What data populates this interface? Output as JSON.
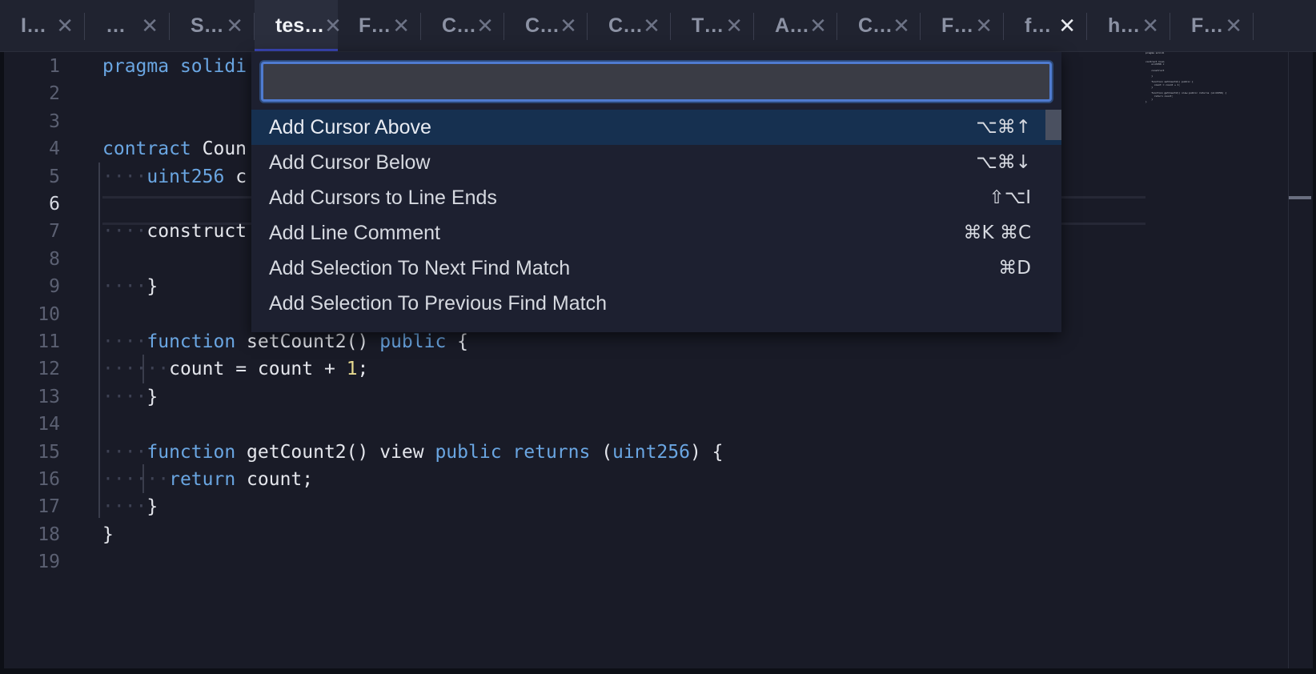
{
  "tabs": [
    {
      "label": "I…",
      "active": false
    },
    {
      "label": "…",
      "active": false
    },
    {
      "label": "S…",
      "active": false
    },
    {
      "label": "tes…",
      "active": true
    },
    {
      "label": "F…",
      "active": false
    },
    {
      "label": "C…",
      "active": false
    },
    {
      "label": "C…",
      "active": false
    },
    {
      "label": "C…",
      "active": false
    },
    {
      "label": "T…",
      "active": false
    },
    {
      "label": "A…",
      "active": false
    },
    {
      "label": "C…",
      "active": false
    },
    {
      "label": "F…",
      "active": false
    },
    {
      "label": "f…",
      "active": false
    },
    {
      "label": "h…",
      "active": false
    },
    {
      "label": "F…",
      "active": false
    }
  ],
  "tab_close_glyph": "✕",
  "editor": {
    "current_line": 6,
    "line_numbers": [
      "1",
      "2",
      "3",
      "4",
      "5",
      "6",
      "7",
      "8",
      "9",
      "10",
      "11",
      "12",
      "13",
      "14",
      "15",
      "16",
      "17",
      "18",
      "19"
    ],
    "lines": [
      "pragma solidi",
      "",
      "",
      "contract Coun",
      "    uint256 c",
      "",
      "    construct",
      "",
      "    }",
      "",
      "    function setCount2() public {",
      "      count = count + 1;",
      "    }",
      "",
      "    function getCount2() view public returns (uint256) {",
      "      return count;",
      "    }",
      "}",
      ""
    ]
  },
  "command_palette": {
    "input_value": "",
    "items": [
      {
        "label": "Add Cursor Above",
        "shortcut": "⌥⌘↑",
        "selected": true
      },
      {
        "label": "Add Cursor Below",
        "shortcut": "⌥⌘↓",
        "selected": false
      },
      {
        "label": "Add Cursors to Line Ends",
        "shortcut": "⇧⌥I",
        "selected": false
      },
      {
        "label": "Add Line Comment",
        "shortcut": "⌘K ⌘C",
        "selected": false
      },
      {
        "label": "Add Selection To Next Find Match",
        "shortcut": "⌘D",
        "selected": false
      },
      {
        "label": "Add Selection To Previous Find Match",
        "shortcut": "",
        "selected": false
      }
    ]
  },
  "colors": {
    "keyword": "#6aa6e2",
    "number": "#e6d98f",
    "selection": "#163050",
    "accent": "#3b47b8"
  }
}
